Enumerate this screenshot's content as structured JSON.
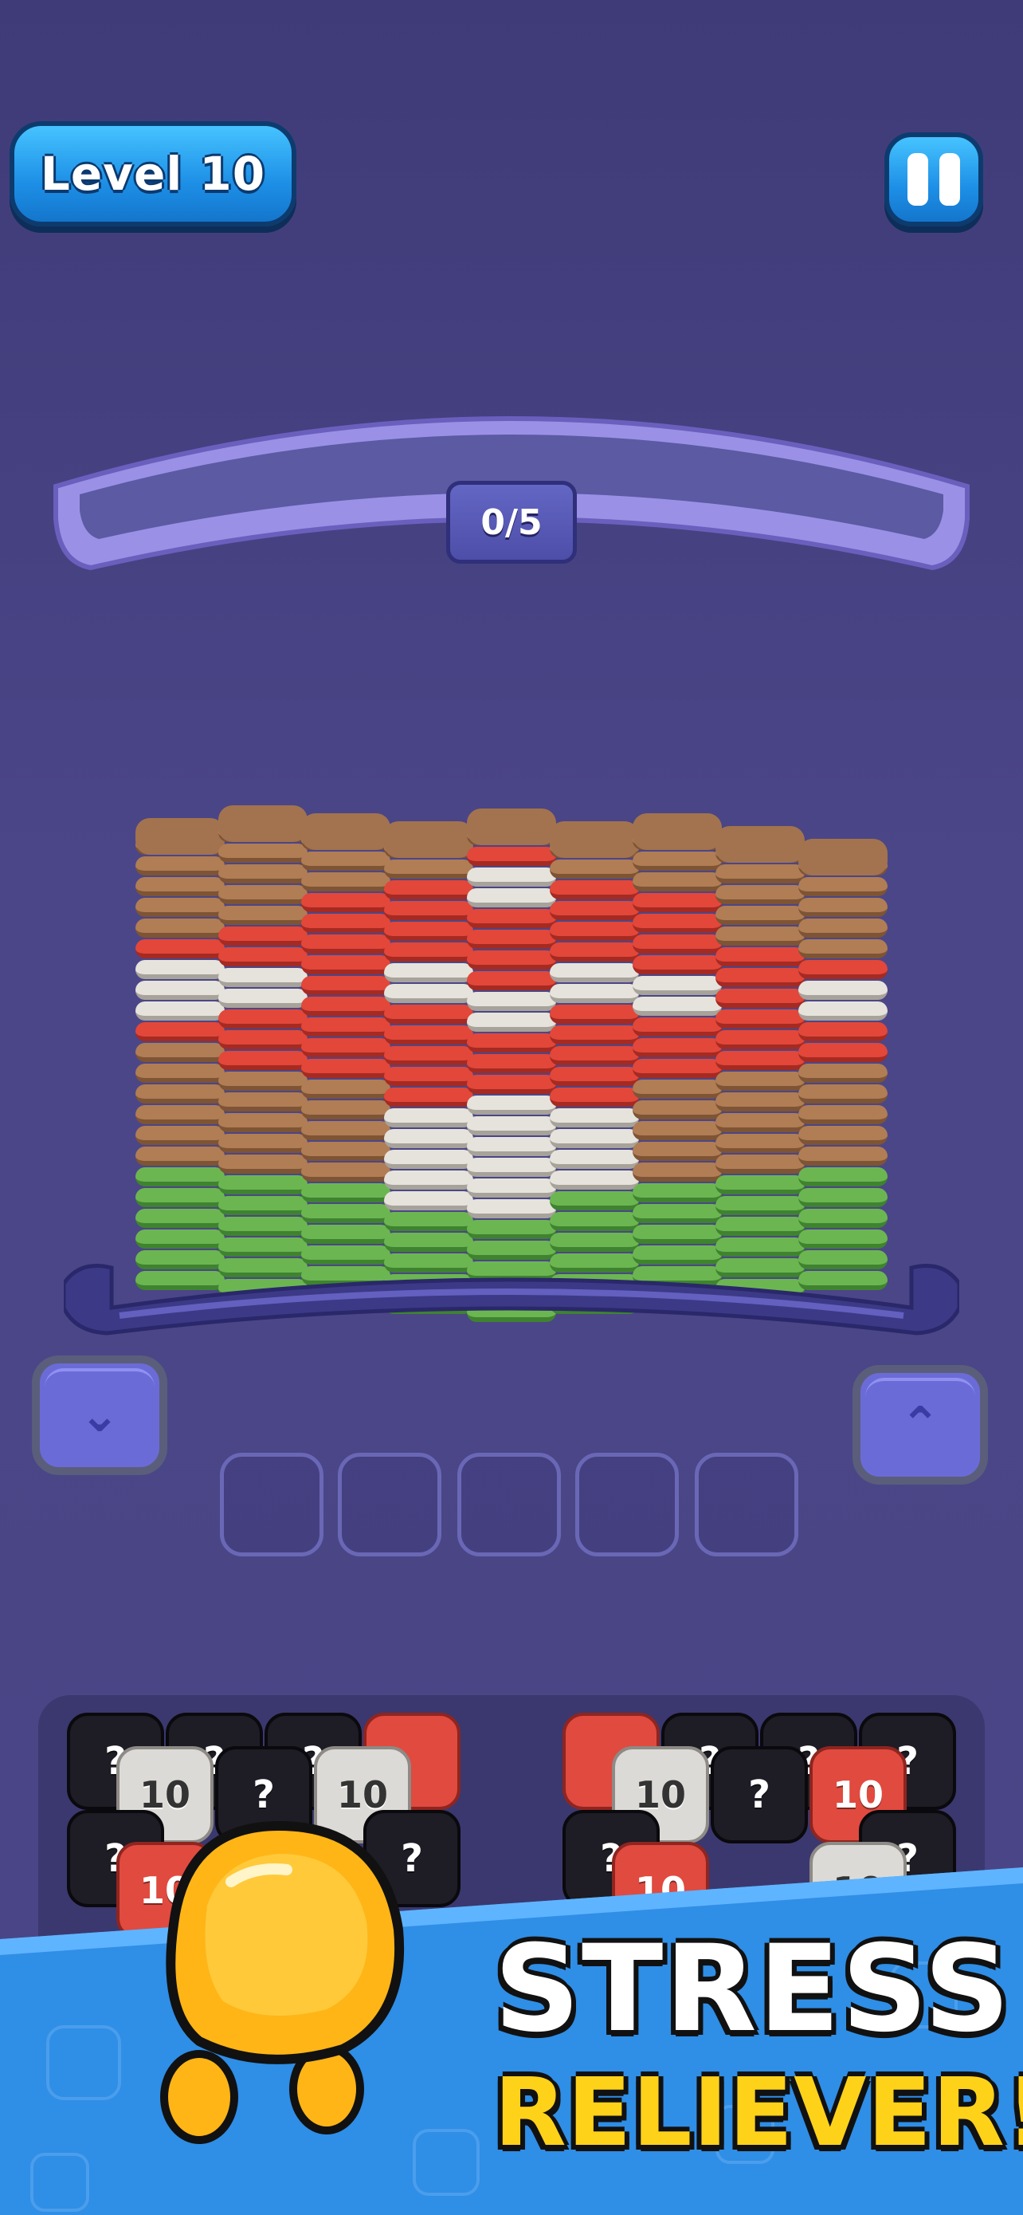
{
  "header": {
    "level_label": "Level 10",
    "pause_icon": "pause-icon"
  },
  "shelf": {
    "counter": "0/5"
  },
  "board": {
    "colors": {
      "brown": "#b07d55",
      "red": "#e2473a",
      "white": "#e6e3dc",
      "green": "#6cb652"
    },
    "columns": [
      [
        "green",
        "green",
        "green",
        "green",
        "green",
        "green",
        "brown",
        "brown",
        "brown",
        "brown",
        "brown",
        "brown",
        "red",
        "white",
        "white",
        "white",
        "red",
        "brown",
        "brown",
        "brown",
        "brown",
        "brown"
      ],
      [
        "green",
        "green",
        "green",
        "green",
        "green",
        "green",
        "brown",
        "brown",
        "brown",
        "brown",
        "brown",
        "red",
        "red",
        "red",
        "white",
        "white",
        "red",
        "red",
        "brown",
        "brown",
        "brown",
        "brown",
        "brown"
      ],
      [
        "green",
        "green",
        "green",
        "green",
        "green",
        "green",
        "brown",
        "brown",
        "brown",
        "brown",
        "brown",
        "red",
        "red",
        "red",
        "red",
        "red",
        "red",
        "red",
        "red",
        "red",
        "brown",
        "brown",
        "brown"
      ],
      [
        "green",
        "green",
        "green",
        "green",
        "green",
        "white",
        "white",
        "white",
        "white",
        "white",
        "red",
        "red",
        "red",
        "red",
        "red",
        "white",
        "white",
        "red",
        "red",
        "red",
        "red",
        "brown",
        "brown"
      ],
      [
        "green",
        "green",
        "green",
        "green",
        "green",
        "white",
        "white",
        "white",
        "white",
        "white",
        "white",
        "red",
        "red",
        "red",
        "white",
        "white",
        "red",
        "red",
        "red",
        "red",
        "white",
        "white",
        "red",
        "brown"
      ],
      [
        "green",
        "green",
        "green",
        "green",
        "green",
        "green",
        "white",
        "white",
        "white",
        "white",
        "red",
        "red",
        "red",
        "red",
        "red",
        "white",
        "white",
        "red",
        "red",
        "red",
        "red",
        "brown",
        "brown"
      ],
      [
        "green",
        "green",
        "green",
        "green",
        "green",
        "green",
        "brown",
        "brown",
        "brown",
        "brown",
        "brown",
        "red",
        "red",
        "red",
        "white",
        "white",
        "red",
        "red",
        "red",
        "red",
        "brown",
        "brown",
        "brown"
      ],
      [
        "green",
        "green",
        "green",
        "green",
        "green",
        "green",
        "brown",
        "brown",
        "brown",
        "brown",
        "brown",
        "red",
        "red",
        "red",
        "red",
        "red",
        "red",
        "brown",
        "brown",
        "brown",
        "brown",
        "brown"
      ],
      [
        "green",
        "green",
        "green",
        "green",
        "green",
        "green",
        "brown",
        "brown",
        "brown",
        "brown",
        "brown",
        "red",
        "red",
        "white",
        "white",
        "red",
        "brown",
        "brown",
        "brown",
        "brown",
        "brown"
      ]
    ]
  },
  "controls": {
    "down_icon": "chevron-down-icon",
    "up_icon": "chevron-up-icon",
    "slot_count": 5
  },
  "queue": {
    "left": [
      {
        "type": "black",
        "label": "?"
      },
      {
        "type": "black",
        "label": "?"
      },
      {
        "type": "black",
        "label": "?"
      },
      {
        "type": "redb",
        "label": ""
      },
      {
        "type": "grey",
        "label": "10"
      },
      {
        "type": "black",
        "label": "?"
      },
      {
        "type": "grey",
        "label": "10"
      },
      {
        "type": "black",
        "label": "?"
      },
      {
        "type": "redb",
        "label": "10"
      },
      {
        "type": "black",
        "label": "?"
      }
    ],
    "right": [
      {
        "type": "redb",
        "label": ""
      },
      {
        "type": "black",
        "label": "?"
      },
      {
        "type": "black",
        "label": "?"
      },
      {
        "type": "black",
        "label": "?"
      },
      {
        "type": "grey",
        "label": "10"
      },
      {
        "type": "black",
        "label": "?"
      },
      {
        "type": "redb",
        "label": "10"
      },
      {
        "type": "black",
        "label": "?"
      },
      {
        "type": "redb",
        "label": "10"
      },
      {
        "type": "black",
        "label": "?"
      },
      {
        "type": "grey",
        "label": "10"
      }
    ]
  },
  "banner": {
    "line1": "STRESS",
    "line2": "RELIEVER!",
    "mascot_icon": "mascot-icon",
    "colors": {
      "banner": "#2f8ee6",
      "mascot": "#ffb516",
      "headline2": "#ffd21a"
    }
  }
}
